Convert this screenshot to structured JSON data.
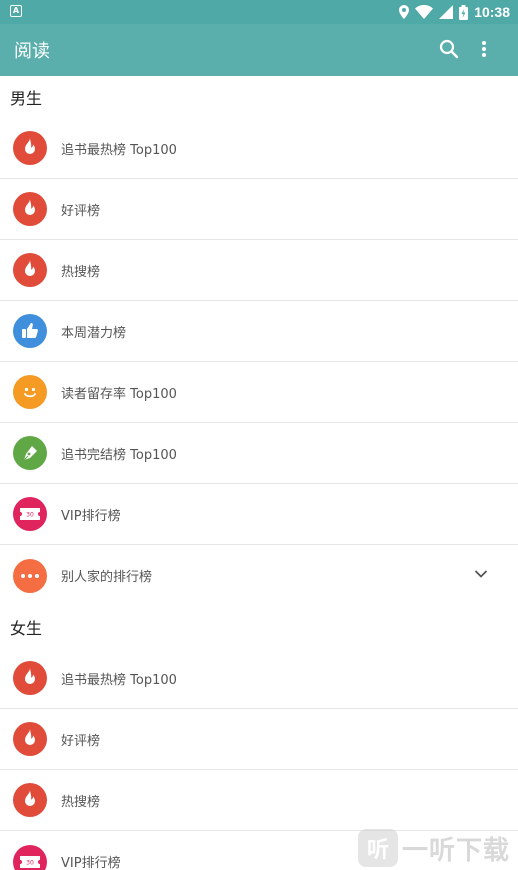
{
  "status_bar": {
    "time": "10:38",
    "left_badge": "A"
  },
  "app_bar": {
    "title": "阅读"
  },
  "sections": [
    {
      "header": "男生",
      "items": [
        {
          "label": "追书最热榜 Top100",
          "icon": "fire-icon",
          "color": "#e04b3a"
        },
        {
          "label": "好评榜",
          "icon": "fire-icon",
          "color": "#e04b3a"
        },
        {
          "label": "热搜榜",
          "icon": "fire-icon",
          "color": "#e04b3a"
        },
        {
          "label": "本周潜力榜",
          "icon": "thumbs-up-icon",
          "color": "#3f8fdc"
        },
        {
          "label": "读者留存率 Top100",
          "icon": "smile-icon",
          "color": "#f59a23"
        },
        {
          "label": "追书完结榜 Top100",
          "icon": "pen-icon",
          "color": "#5fa845"
        },
        {
          "label": "VIP排行榜",
          "icon": "ticket-icon",
          "color": "#e0245e"
        },
        {
          "label": "别人家的排行榜",
          "icon": "more-dots-icon",
          "color": "#f46d43",
          "expandable": true
        }
      ]
    },
    {
      "header": "女生",
      "items": [
        {
          "label": "追书最热榜 Top100",
          "icon": "fire-icon",
          "color": "#e04b3a"
        },
        {
          "label": "好评榜",
          "icon": "fire-icon",
          "color": "#e04b3a"
        },
        {
          "label": "热搜榜",
          "icon": "fire-icon",
          "color": "#e04b3a"
        },
        {
          "label": "VIP排行榜",
          "icon": "ticket-icon",
          "color": "#e0245e"
        }
      ]
    }
  ],
  "watermark": {
    "glyph": "听",
    "text": "一听下载"
  }
}
